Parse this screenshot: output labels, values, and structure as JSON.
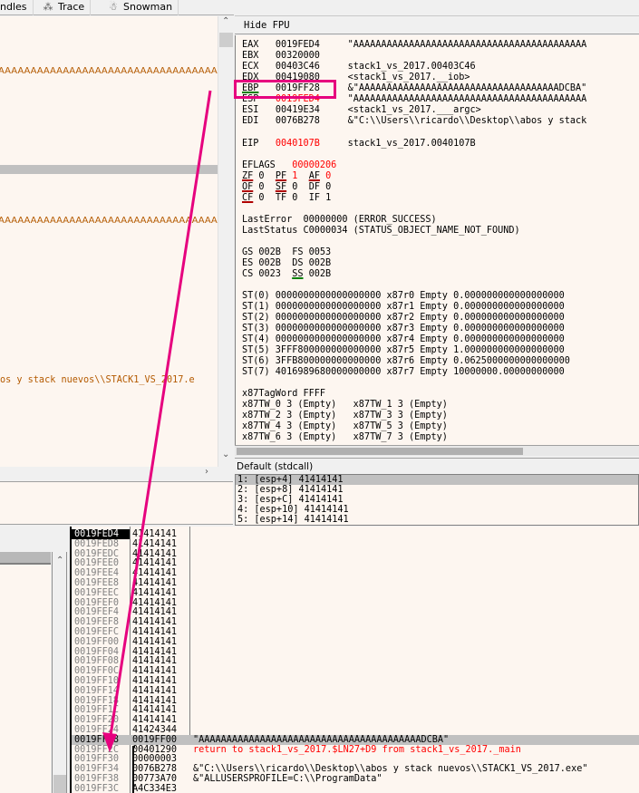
{
  "tabs": [
    {
      "label": "ndles",
      "icon": ""
    },
    {
      "label": "Trace",
      "icon": "footprints-icon"
    },
    {
      "label": "Snowman",
      "icon": "snowman-icon"
    }
  ],
  "disasm": {
    "ascii_line_1": "AAAAAAAAAAAAAAAAAAAAAAAAAAAAAAAAAAAAADCBA",
    "ascii_line_2": "AAAAAAAAAAAAAAAAAAAAAAAAAAAAAAAAAAAAAAAAA",
    "path_line": "os y stack nuevos\\\\STACK1_VS_2017.e"
  },
  "registers_panel": {
    "hide_fpu_label": "Hide FPU",
    "general": [
      {
        "name": "EAX",
        "value": "0019FED4",
        "comment": "\"AAAAAAAAAAAAAAAAAAAAAAAAAAAAAAAAAAAAAAAAAA",
        "changed": false
      },
      {
        "name": "EBX",
        "value": "00320000",
        "comment": "",
        "changed": false
      },
      {
        "name": "ECX",
        "value": "00403C46",
        "comment": "stack1_vs_2017.00403C46",
        "changed": false
      },
      {
        "name": "EDX",
        "value": "00419080",
        "comment": "<stack1_vs_2017.__iob>",
        "changed": false
      },
      {
        "name": "EBP",
        "value": "0019FF28",
        "comment": "&\"AAAAAAAAAAAAAAAAAAAAAAAAAAAAAAAAAAAADCBA\"",
        "changed": false
      },
      {
        "name": "ESP",
        "value": "0019FED4",
        "comment": "\"AAAAAAAAAAAAAAAAAAAAAAAAAAAAAAAAAAAAAAAAAA",
        "changed": true
      },
      {
        "name": "ESI",
        "value": "00419E34",
        "comment": "<stack1_vs_2017.___argc>",
        "changed": false
      },
      {
        "name": "EDI",
        "value": "0076B278",
        "comment": "&\"C:\\\\Users\\\\ricardo\\\\Desktop\\\\abos y stack",
        "changed": false
      }
    ],
    "eip": {
      "name": "EIP",
      "value": "0040107B",
      "comment": "stack1_vs_2017.0040107B"
    },
    "eflags": {
      "name": "EFLAGS",
      "value": "00000206"
    },
    "flags": [
      [
        {
          "name": "ZF",
          "value": "0"
        },
        {
          "name": "PF",
          "value": "1"
        },
        {
          "name": "AF",
          "value": "0"
        }
      ],
      [
        {
          "name": "OF",
          "value": "0"
        },
        {
          "name": "SF",
          "value": "0"
        },
        {
          "name": "DF",
          "value": "0"
        }
      ],
      [
        {
          "name": "CF",
          "value": "0"
        },
        {
          "name": "TF",
          "value": "0"
        },
        {
          "name": "IF",
          "value": "1"
        }
      ]
    ],
    "last_error": "LastError  00000000 (ERROR_SUCCESS)",
    "last_status": "LastStatus C0000034 (STATUS_OBJECT_NAME_NOT_FOUND)",
    "segments": [
      "GS 002B  FS 0053",
      "ES 002B  DS 002B",
      "CS 0023  SS 002B"
    ],
    "fpu": [
      "ST(0) 0000000000000000000 x87r0 Empty 0.000000000000000000",
      "ST(1) 0000000000000000000 x87r1 Empty 0.000000000000000000",
      "ST(2) 0000000000000000000 x87r2 Empty 0.000000000000000000",
      "ST(3) 0000000000000000000 x87r3 Empty 0.000000000000000000",
      "ST(4) 0000000000000000000 x87r4 Empty 0.000000000000000000",
      "ST(5) 3FFF800000000000000 x87r5 Empty 1.000000000000000000",
      "ST(6) 3FFB800000000000000 x87r6 Empty 0.0625000000000000000",
      "ST(7) 4016989680000000000 x87r7 Empty 10000000.00000000000"
    ],
    "tagword": "x87TagWord FFFF",
    "tw": [
      "x87TW_0 3 (Empty)   x87TW_1 3 (Empty)",
      "x87TW_2 3 (Empty)   x87TW_3 3 (Empty)",
      "x87TW_4 3 (Empty)   x87TW_5 3 (Empty)",
      "x87TW_6 3 (Empty)   x87TW_7 3 (Empty)"
    ]
  },
  "call_convention": {
    "label": "Default (stdcall)",
    "args": [
      "1: [esp+4] 41414141",
      "2: [esp+8] 41414141",
      "3: [esp+C] 41414141",
      "4: [esp+10] 41414141",
      "5: [esp+14] 41414141"
    ]
  },
  "stack": {
    "rows": [
      {
        "addr": "0019FED4",
        "value": "41414141",
        "comment": ""
      },
      {
        "addr": "0019FED8",
        "value": "41414141",
        "comment": ""
      },
      {
        "addr": "0019FEDC",
        "value": "41414141",
        "comment": ""
      },
      {
        "addr": "0019FEE0",
        "value": "41414141",
        "comment": ""
      },
      {
        "addr": "0019FEE4",
        "value": "41414141",
        "comment": ""
      },
      {
        "addr": "0019FEE8",
        "value": "41414141",
        "comment": ""
      },
      {
        "addr": "0019FEEC",
        "value": "41414141",
        "comment": ""
      },
      {
        "addr": "0019FEF0",
        "value": "41414141",
        "comment": ""
      },
      {
        "addr": "0019FEF4",
        "value": "41414141",
        "comment": ""
      },
      {
        "addr": "0019FEF8",
        "value": "41414141",
        "comment": ""
      },
      {
        "addr": "0019FEFC",
        "value": "41414141",
        "comment": ""
      },
      {
        "addr": "0019FF00",
        "value": "41414141",
        "comment": ""
      },
      {
        "addr": "0019FF04",
        "value": "41414141",
        "comment": ""
      },
      {
        "addr": "0019FF08",
        "value": "41414141",
        "comment": ""
      },
      {
        "addr": "0019FF0C",
        "value": "41414141",
        "comment": ""
      },
      {
        "addr": "0019FF10",
        "value": "41414141",
        "comment": ""
      },
      {
        "addr": "0019FF14",
        "value": "41414141",
        "comment": ""
      },
      {
        "addr": "0019FF18",
        "value": "41414141",
        "comment": ""
      },
      {
        "addr": "0019FF1C",
        "value": "41414141",
        "comment": ""
      },
      {
        "addr": "0019FF20",
        "value": "41414141",
        "comment": ""
      },
      {
        "addr": "0019FF24",
        "value": "41424344",
        "comment": ""
      },
      {
        "addr": "0019FF28",
        "value": "0019FF00",
        "comment": "\"AAAAAAAAAAAAAAAAAAAAAAAAAAAAAAAAAAAAAAAADCBA\""
      },
      {
        "addr": "0019FF2C",
        "value": "00401290",
        "comment": "return to stack1_vs_2017.$LN27+D9 from stack1_vs_2017._main"
      },
      {
        "addr": "0019FF30",
        "value": "00000003",
        "comment": ""
      },
      {
        "addr": "0019FF34",
        "value": "0076B278",
        "comment": "&\"C:\\\\Users\\\\ricardo\\\\Desktop\\\\abos y stack nuevos\\\\STACK1_VS_2017.exe\""
      },
      {
        "addr": "0019FF38",
        "value": "00773A70",
        "comment": "&\"ALLUSERSPROFILE=C:\\\\ProgramData\""
      },
      {
        "addr": "0019FF3C",
        "value": "A4C334E3",
        "comment": ""
      }
    ]
  },
  "colors": {
    "accent_annotation": "#e6007e",
    "changed_value": "#ff0000",
    "panel_bg": "#fdf6f0"
  }
}
